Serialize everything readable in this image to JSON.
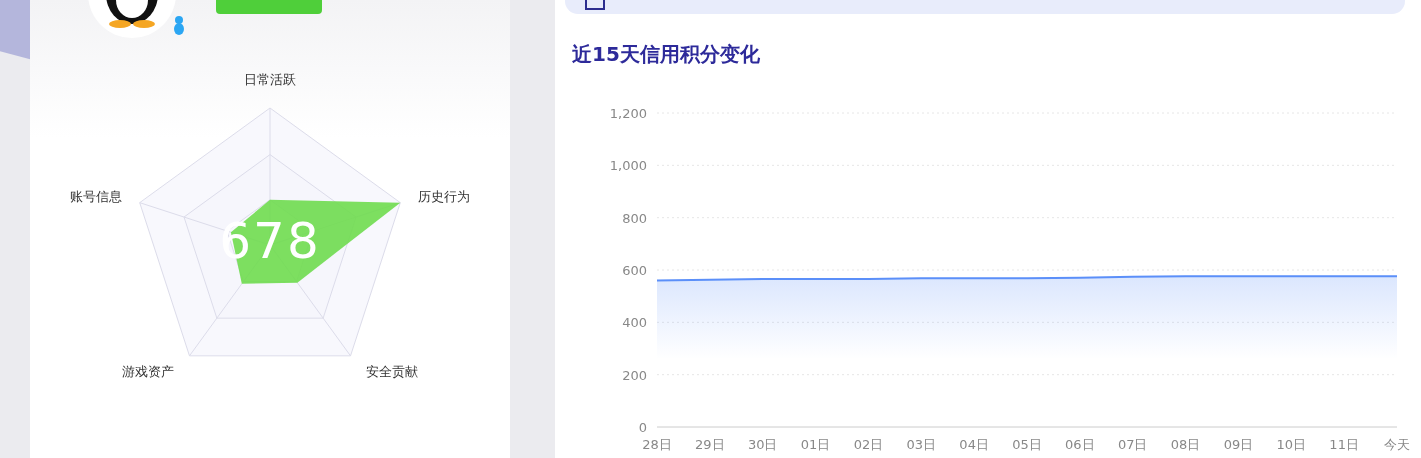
{
  "credit_card": {
    "score": "678",
    "radar_labels": [
      "日常活跃",
      "历史行为",
      "安全贡献",
      "游戏资产",
      "账号信息"
    ]
  },
  "trend_card": {
    "title": "近15天信用积分变化",
    "chart_data": {
      "type": "area",
      "categories": [
        "28日",
        "29日",
        "30日",
        "01日",
        "02日",
        "03日",
        "04日",
        "05日",
        "06日",
        "07日",
        "08日",
        "09日",
        "10日",
        "11日",
        "今天"
      ],
      "series": [
        {
          "color": "#5b8ff9",
          "values": [
            560,
            563,
            566,
            566,
            566,
            568,
            568,
            568,
            570,
            574,
            576,
            576,
            576,
            576,
            576
          ]
        }
      ],
      "ylim": [
        0,
        1200
      ],
      "yticks": [
        0,
        200,
        400,
        600,
        800,
        {
          "value": 1000,
          "label": "1,000"
        },
        {
          "value": 1200,
          "label": "1,200"
        }
      ],
      "grid": true
    }
  }
}
